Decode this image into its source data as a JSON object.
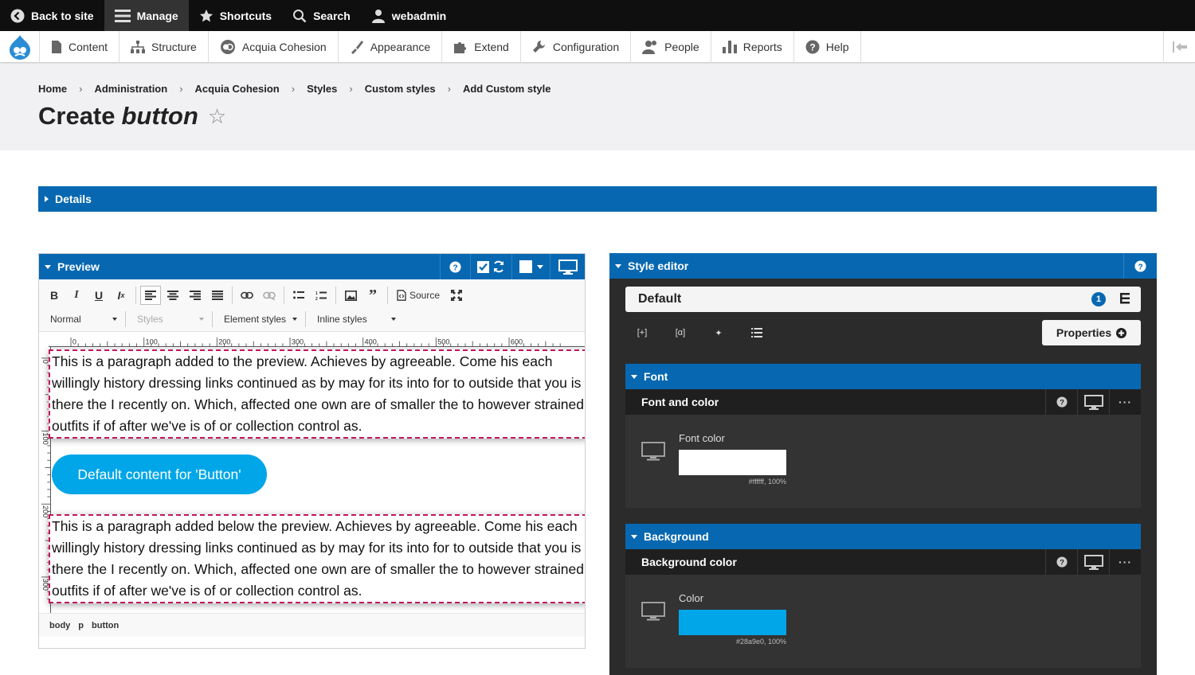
{
  "toolbar": {
    "back": "Back to site",
    "manage": "Manage",
    "shortcuts": "Shortcuts",
    "search": "Search",
    "user": "webadmin"
  },
  "admin_menu": [
    "Content",
    "Structure",
    "Acquia Cohesion",
    "Appearance",
    "Extend",
    "Configuration",
    "People",
    "Reports",
    "Help"
  ],
  "breadcrumb": [
    "Home",
    "Administration",
    "Acquia Cohesion",
    "Styles",
    "Custom styles",
    "Add Custom style"
  ],
  "page_title": {
    "prefix": "Create",
    "emph": "button"
  },
  "details": {
    "label": "Details"
  },
  "preview": {
    "label": "Preview",
    "source_label": "Source",
    "format": "Normal",
    "styles": "Styles",
    "element_styles": "Element styles",
    "inline_styles": "Inline styles",
    "ruler": [
      "0",
      "100",
      "200",
      "300",
      "400",
      "500",
      "600"
    ],
    "ruler_left": [
      "0",
      "100",
      "200",
      "300"
    ],
    "para_top": "This is a paragraph added to the preview. Achieves by agreeable. Come his each willingly history dressing links continued as by may for its into for to outside that you is there the I recently on. Which, affected one own are of smaller the to however strained outfits if of after we've is of or collection control as.",
    "button_text": "Default content for 'Button'",
    "para_bottom": "This is a paragraph added below the preview. Achieves by agreeable. Come his each willingly history dressing links continued as by may for its into for to outside that you is there the I recently on. Which, affected one own are of smaller the to however strained outfits if of after we've is of or collection control as.",
    "path": [
      "body",
      "p",
      "button"
    ]
  },
  "style_editor": {
    "label": "Style editor",
    "selector": "Default",
    "badge": "1",
    "properties": "Properties",
    "font": {
      "section": "Font",
      "group": "Font and color",
      "field": "Font color",
      "value": "#ffffff, 100%",
      "color": "#ffffff"
    },
    "background": {
      "section": "Background",
      "group": "Background color",
      "field": "Color",
      "value": "#28a9e0, 100%",
      "color": "#00a6e8"
    }
  },
  "colors": {
    "accent": "#0768b1",
    "button": "#00a6e8",
    "highlight": "#c0185e"
  }
}
